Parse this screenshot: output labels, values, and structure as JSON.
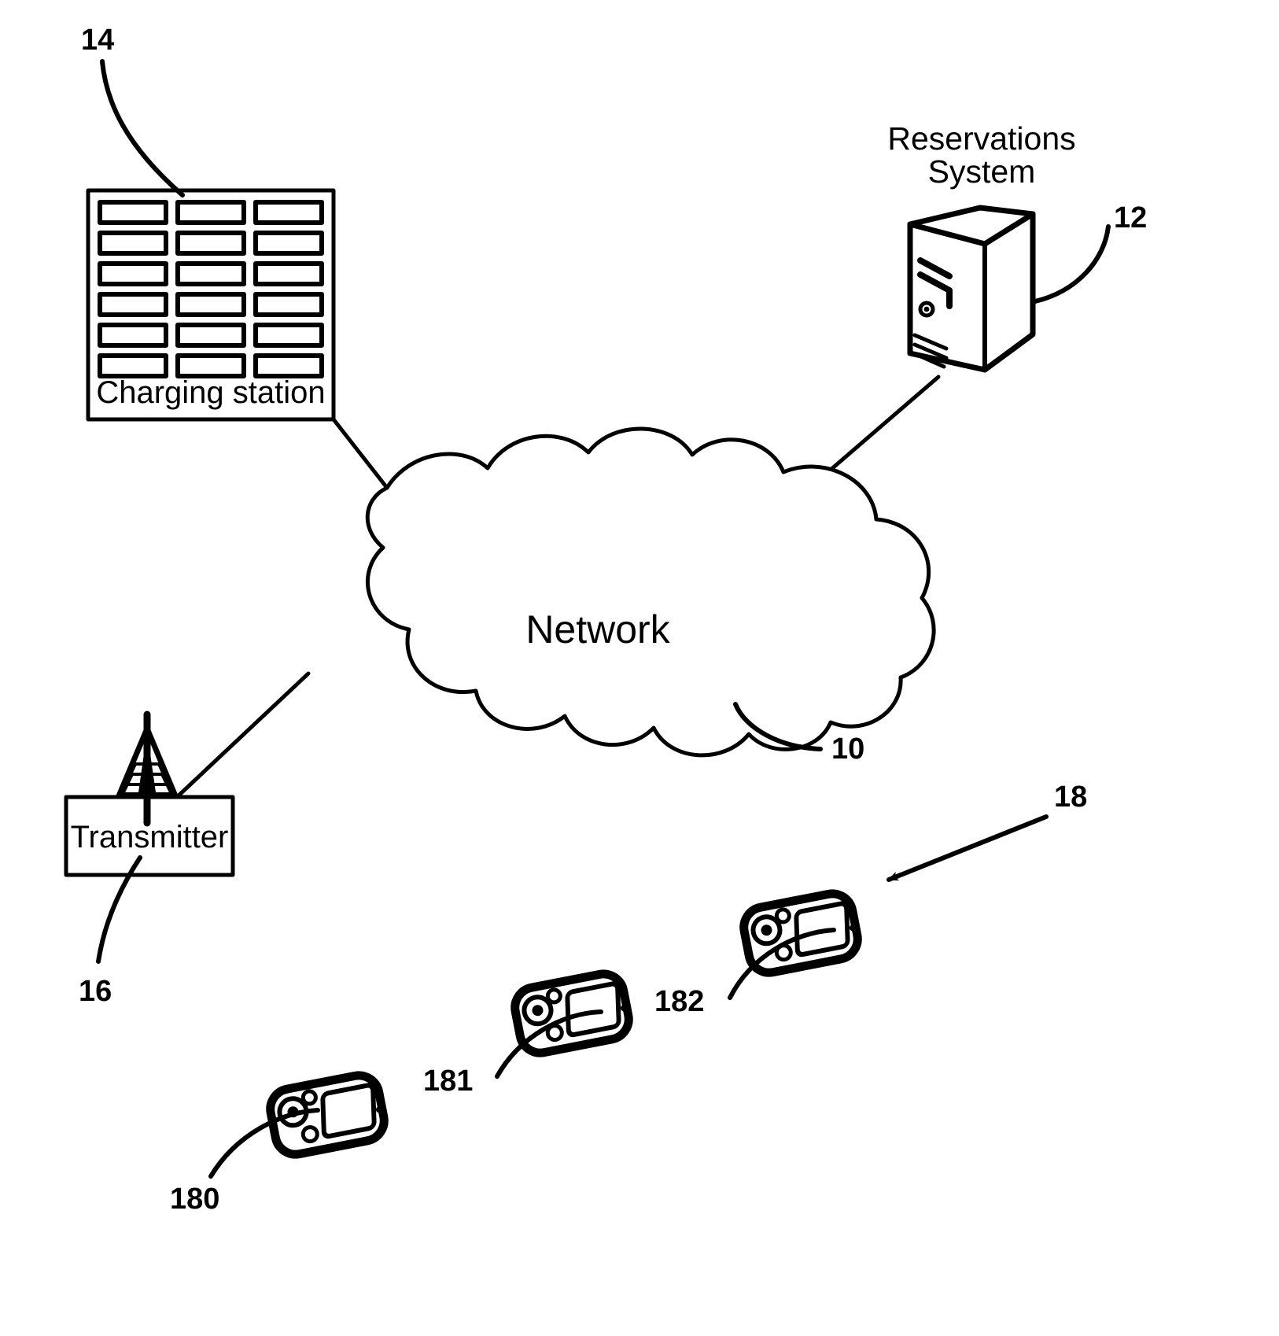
{
  "figure": {
    "type": "patent-network-diagram",
    "background_color": "#ffffff",
    "line_color": "#000000"
  },
  "nodes": {
    "charging_station": {
      "label": "Charging station",
      "ref": "14",
      "slot_rows": 6,
      "slot_cols": 3,
      "slot_count": 18
    },
    "reservations_system": {
      "label_line1": "Reservations",
      "label_line2": "System",
      "ref": "12",
      "icon": "server-tower-icon"
    },
    "network_cloud": {
      "label": "Network",
      "ref": "10",
      "icon": "cloud-icon"
    },
    "transmitter": {
      "label": "Transmitter",
      "ref": "16",
      "icon": "antenna-tower-icon"
    },
    "mobile_devices": {
      "group_ref": "18",
      "items": [
        {
          "ref": "180",
          "icon": "handheld-device-icon"
        },
        {
          "ref": "181",
          "icon": "handheld-device-icon"
        },
        {
          "ref": "182",
          "icon": "handheld-device-icon"
        }
      ]
    }
  },
  "connections": [
    {
      "from": "charging_station",
      "to": "network_cloud"
    },
    {
      "from": "reservations_system",
      "to": "network_cloud"
    },
    {
      "from": "transmitter",
      "to": "network_cloud"
    }
  ]
}
